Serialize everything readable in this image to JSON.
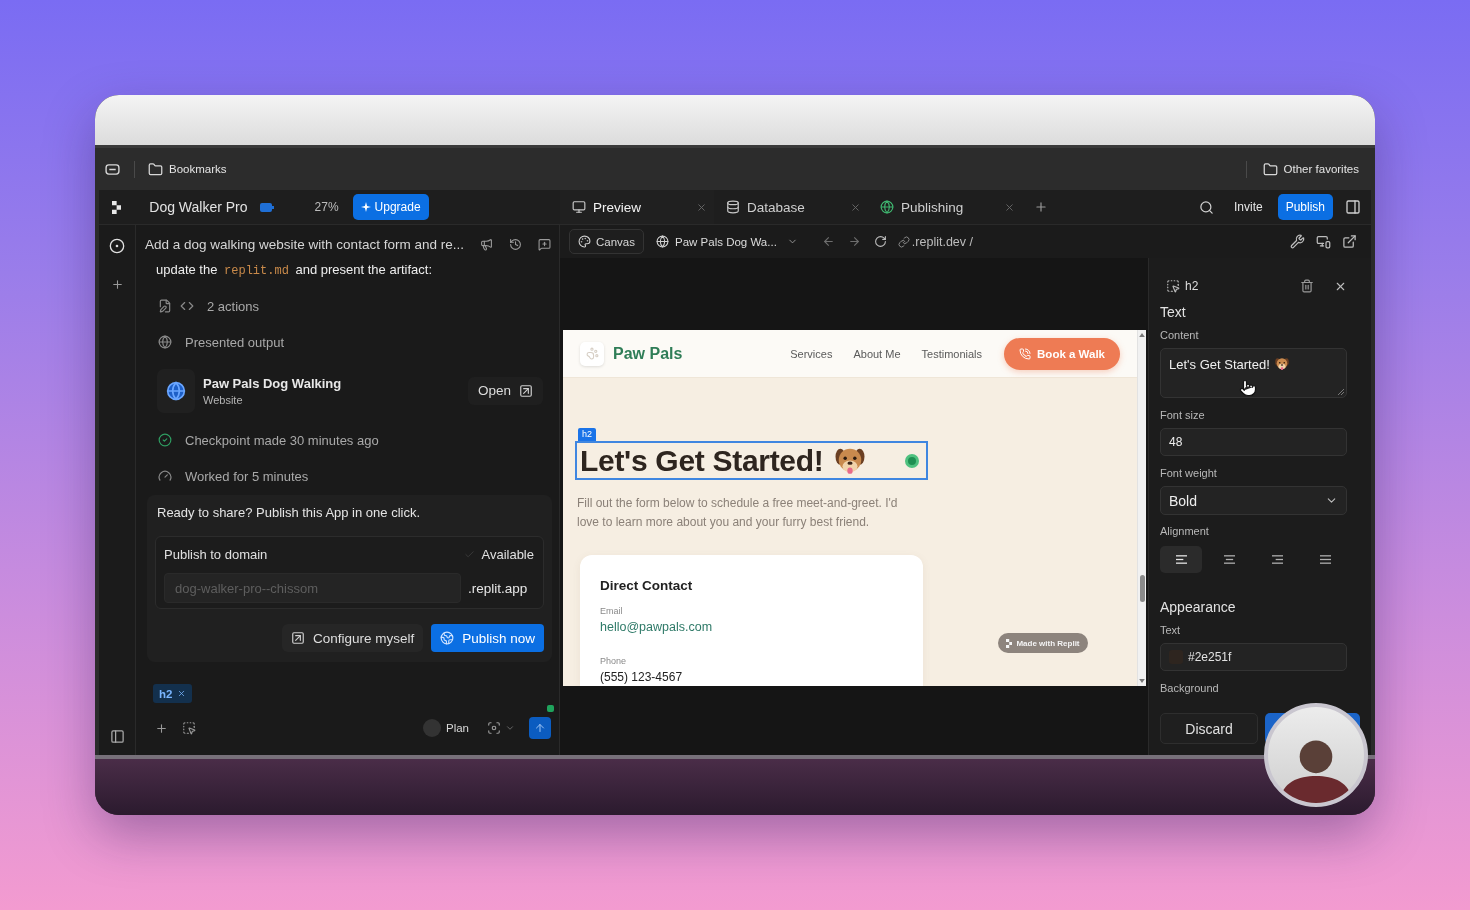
{
  "bookmarks_bar": {
    "left_folder": "Bookmarks",
    "right_folder": "Other favorites"
  },
  "top_bar": {
    "project": "Dog Walker Pro",
    "usage": "27%",
    "upgrade": "Upgrade",
    "tabs": [
      {
        "kind": "preview",
        "label": "Preview",
        "selected": true
      },
      {
        "kind": "database",
        "label": "Database",
        "selected": false
      },
      {
        "kind": "publishing",
        "label": "Publishing",
        "selected": false
      }
    ],
    "invite": "Invite",
    "publish": "Publish"
  },
  "chat": {
    "title": "Add a dog walking website with contact form and re...",
    "message": [
      {
        "kind": "text",
        "text": "update the "
      },
      {
        "kind": "code",
        "text": "replit.md"
      },
      {
        "kind": "text",
        "text": " and present the artifact:"
      }
    ],
    "actions": "2 actions",
    "presented": "Presented output",
    "artifact": {
      "title": "Paw Pals Dog Walking",
      "subtitle": "Website",
      "open": "Open"
    },
    "checkpoint": "Checkpoint made 30 minutes ago",
    "worked": "Worked for 5 minutes",
    "publish_card": {
      "prompt": "Ready to share? Publish this App in one click.",
      "domain_label": "Publish to domain",
      "status": "Available",
      "domain_placeholder": "dog-walker-pro--chissom",
      "suffix": ".replit.app",
      "configure": "Configure myself",
      "publish": "Publish now"
    }
  },
  "composer": {
    "chip": "h2",
    "plan": "Plan",
    "plan_on": false
  },
  "preview_toolbar": {
    "canvas": "Canvas",
    "app": "Paw Pals Dog Wa...",
    "url": ".replit.dev /"
  },
  "site": {
    "brand": "Paw Pals",
    "nav": [
      "Services",
      "About Me",
      "Testimonials"
    ],
    "cta": "Book a Walk",
    "selected_tag": "h2",
    "heading": "Let's Get Started!",
    "intro": "Fill out the form below to schedule a free meet-and-greet. I'd love to learn more about you and your furry best friend.",
    "contact": {
      "title": "Direct Contact",
      "fields": [
        {
          "kind": "link",
          "label": "Email",
          "value": "hello@pawpals.com"
        },
        {
          "kind": "text",
          "label": "Phone",
          "value": "(555) 123-4567"
        }
      ]
    },
    "badge": "Made with Replit"
  },
  "inspector": {
    "element": "h2",
    "text_section": "Text",
    "content_label": "Content",
    "content_value": "Let's Get Started!",
    "font_size_label": "Font size",
    "font_size": "48",
    "font_weight_label": "Font weight",
    "font_weight": "Bold",
    "alignment_label": "Alignment",
    "alignments": [
      {
        "kind": "left",
        "selected": true
      },
      {
        "kind": "center",
        "selected": false
      },
      {
        "kind": "right",
        "selected": false
      },
      {
        "kind": "justify",
        "selected": false
      }
    ],
    "appearance_section": "Appearance",
    "text_color_label": "Text",
    "text_color": "#2e251f",
    "background_label": "Background",
    "discard": "Discard"
  }
}
